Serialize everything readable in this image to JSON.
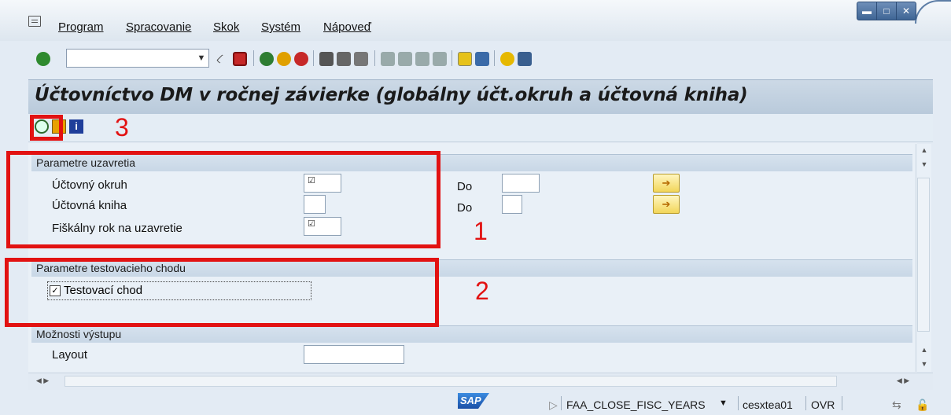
{
  "menu": {
    "items": [
      "Program",
      "Spracovanie",
      "Skok",
      "Systém",
      "Nápoveď"
    ]
  },
  "page": {
    "title": "Účtovníctvo DM v ročnej závierke (globálny účt.okruh a účtovná kniha)"
  },
  "groups": {
    "closing_params": {
      "header": "Parametre uzavretia",
      "company_code_label": "Účtovný okruh",
      "ledger_label": "Účtovná kniha",
      "fiscal_year_label": "Fiškálny rok na uzavretie",
      "to_label_1": "Do",
      "to_label_2": "Do"
    },
    "test_run": {
      "header": "Parametre testovacieho chodu",
      "checkbox_label": "Testovací chod",
      "checked": true
    },
    "output": {
      "header": "Možnosti výstupu",
      "layout_label": "Layout"
    }
  },
  "annotations": {
    "box1": "1",
    "box2": "2",
    "box3": "3"
  },
  "status": {
    "sap_logo": "SAP",
    "transaction": "FAA_CLOSE_FISC_YEARS",
    "server": "cesxtea01",
    "mode": "OVR"
  },
  "colors": {
    "annotation_red": "#e21212",
    "title_bg": "#ccd9e6",
    "group_header_bg": "#d6e2ee"
  }
}
